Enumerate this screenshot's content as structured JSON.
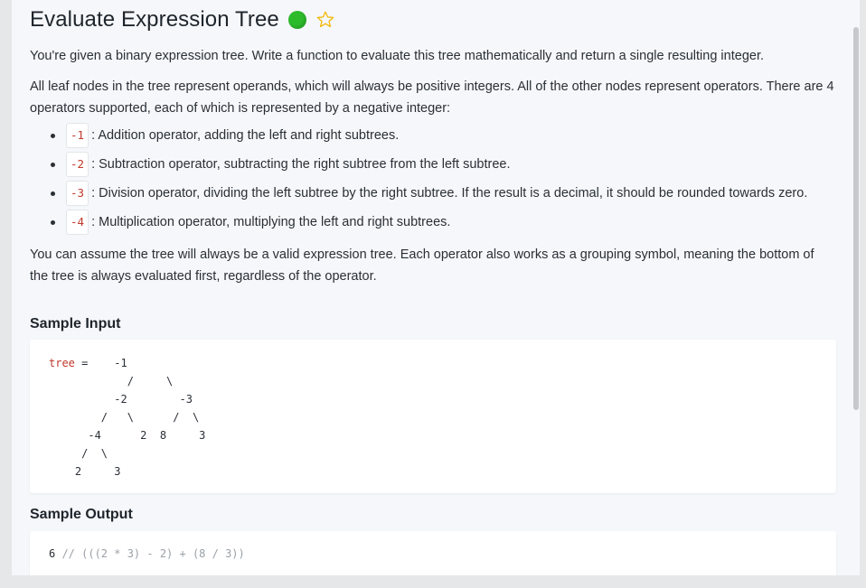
{
  "title": "Evaluate Expression Tree",
  "status_color": "#2dbb2c",
  "favorite_icon": "star-outline-icon",
  "description": {
    "intro": "You're given a binary expression tree. Write a function to evaluate this tree mathematically and return a single resulting integer.",
    "leaves": "All leaf nodes in the tree represent operands, which will always be positive integers. All of the other nodes represent operators. There are 4 operators supported, each of which is represented by a negative integer:",
    "operators": [
      {
        "code": "-1",
        "text": ": Addition operator, adding the left and right subtrees."
      },
      {
        "code": "-2",
        "text": ": Subtraction operator, subtracting the right subtree from the left subtree."
      },
      {
        "code": "-3",
        "text": ": Division operator, dividing the left subtree by the right subtree. If the result is a decimal, it should be rounded towards zero."
      },
      {
        "code": "-4",
        "text": ": Multiplication operator, multiplying the left and right subtrees."
      }
    ],
    "assumption": "You can assume the tree will always be a valid expression tree. Each operator also works as a grouping symbol, meaning the bottom of the tree is always evaluated first, regardless of the operator."
  },
  "sample_input": {
    "heading": "Sample Input",
    "var": "tree",
    "eq": " = ",
    "line1": "   -1",
    "lines": [
      "            /     \\",
      "          -2        -3",
      "        /   \\      /  \\",
      "      -4      2  8     3",
      "     /  \\",
      "    2     3"
    ]
  },
  "sample_output": {
    "heading": "Sample Output",
    "value": "6",
    "comment": " // (((2 * 3) - 2) + (8 / 3))"
  }
}
